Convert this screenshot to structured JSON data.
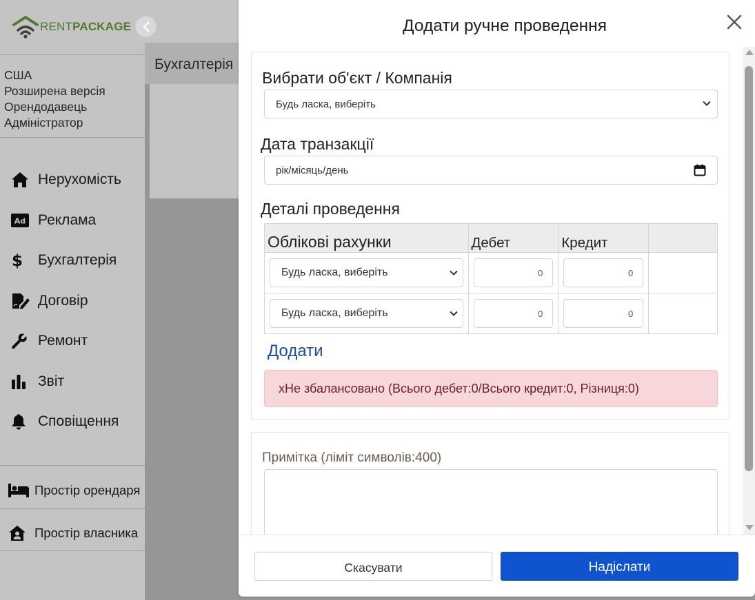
{
  "app": {
    "brand_rent": "RENT",
    "brand_package": "PACKAGE",
    "brand_color": "#6a9f3c"
  },
  "user": {
    "country": "США",
    "plan": "Розширена версія",
    "role": "Орендодавець",
    "level": "Адміністратор"
  },
  "sidebar": {
    "items": [
      {
        "label": "Нерухомість",
        "icon": "home-icon"
      },
      {
        "label": "Реклама",
        "icon": "ad-icon"
      },
      {
        "label": "Бухгалтерія",
        "icon": "dollar-icon"
      },
      {
        "label": "Договір",
        "icon": "contract-icon"
      },
      {
        "label": "Ремонт",
        "icon": "wrench-icon"
      },
      {
        "label": "Звіт",
        "icon": "chart-icon"
      },
      {
        "label": "Сповіщення",
        "icon": "bell-icon"
      }
    ],
    "bottom": [
      {
        "label": "Простір орендаря",
        "icon": "bed-icon"
      },
      {
        "label": "Простір власника",
        "icon": "house-user-icon"
      }
    ]
  },
  "page": {
    "breadcrumb": "Бухгалтерія"
  },
  "modal": {
    "title": "Додати ручне проведення",
    "close_glyph": "✕",
    "object_label": "Вибрати об'єкт / Компанія",
    "object_select_value": "Будь ласка, виберіть",
    "date_label": "Дата транзакції",
    "date_placeholder": "рік/місяць/день",
    "details_label": "Деталі проведення",
    "table": {
      "headers": [
        "Облікові рахунки",
        "Дебет",
        "Кредит",
        ""
      ],
      "rows": [
        {
          "account": "Будь ласка, виберіть",
          "debit": "0",
          "credit": "0"
        },
        {
          "account": "Будь ласка, виберіть",
          "debit": "0",
          "credit": "0"
        }
      ]
    },
    "add_link": "Додати",
    "alert": "xНе збалансовано (Всього дебет:0/Всього кредит:0, Різниця:0)",
    "note_label": "Примітка (ліміт символів:400)",
    "note_value": "",
    "cancel_label": "Скасувати",
    "submit_label": "Надіслати",
    "submit_color": "#0f53cf",
    "alert_color": "#f8d7da"
  }
}
